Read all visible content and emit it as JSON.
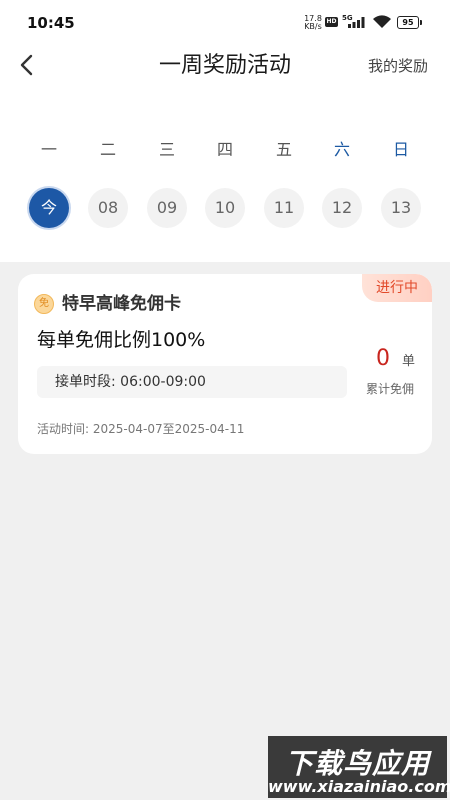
{
  "status_bar": {
    "time": "10:45",
    "net_speed": "17.8",
    "net_unit": "KB/s",
    "hd": "HD",
    "network_type": "5G",
    "battery": "95"
  },
  "header": {
    "title": "一周奖励活动",
    "my_rewards": "我的奖励"
  },
  "week": {
    "days": [
      "一",
      "二",
      "三",
      "四",
      "五",
      "六",
      "日"
    ],
    "dates": [
      "今",
      "08",
      "09",
      "10",
      "11",
      "12",
      "13"
    ],
    "selected_index": 0
  },
  "card": {
    "status_tag": "进行中",
    "badge": "免",
    "title": "特早高峰免佣卡",
    "rate": "每单免佣比例100%",
    "time_slot": "接单时段: 06:00-09:00",
    "period": "活动时间: 2025-04-07至2025-04-11",
    "count": "0",
    "count_unit": "单",
    "count_label": "累计免佣"
  },
  "watermark": {
    "line1": "下载鸟应用",
    "line2": "www.xiazainiao.com"
  },
  "colors": {
    "accent": "#1d58a6",
    "weekend": "#1d5aa3",
    "tag_text": "#e24a2a",
    "count": "#c8251e",
    "background": "#f0f0f0"
  }
}
